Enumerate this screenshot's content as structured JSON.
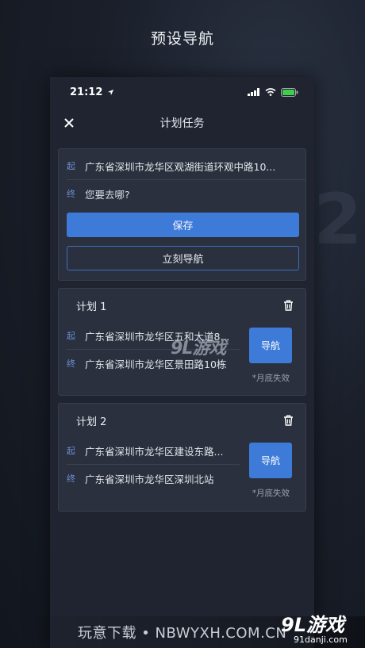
{
  "banner": {
    "title": "预设导航"
  },
  "status": {
    "time": "21:12"
  },
  "navbar": {
    "title": "计划任务"
  },
  "editor": {
    "start_tag": "起",
    "start_value": "广东省深圳市龙华区观湖街道环观中路10...",
    "end_tag": "终",
    "end_placeholder": "您要去哪?",
    "save_label": "保存",
    "navigate_now_label": "立刻导航"
  },
  "plans": [
    {
      "name": "计划 1",
      "start_tag": "起",
      "start": "广东省深圳市龙华区五和大道8...",
      "end_tag": "终",
      "end": "广东省深圳市龙华区景田路10栋",
      "nav_label": "导航",
      "expire": "*月底失效"
    },
    {
      "name": "计划 2",
      "start_tag": "起",
      "start": "广东省深圳市龙华区建设东路...",
      "end_tag": "终",
      "end": "广东省深圳市龙华区深圳北站",
      "nav_label": "导航",
      "expire": "*月底失效"
    }
  ],
  "watermarks": {
    "mid": "9L游戏",
    "footer": "玩意下载 • NBWYXH.COM.CN",
    "logo_big": "9L游戏",
    "logo_small": "91danji.com"
  },
  "colors": {
    "accent": "#3e7bd8",
    "card": "#2a303d",
    "phone_bg": "#1f2430"
  },
  "icons": [
    "location-arrow-icon",
    "signal-icon",
    "wifi-icon",
    "battery-icon",
    "close-icon",
    "trash-icon"
  ]
}
